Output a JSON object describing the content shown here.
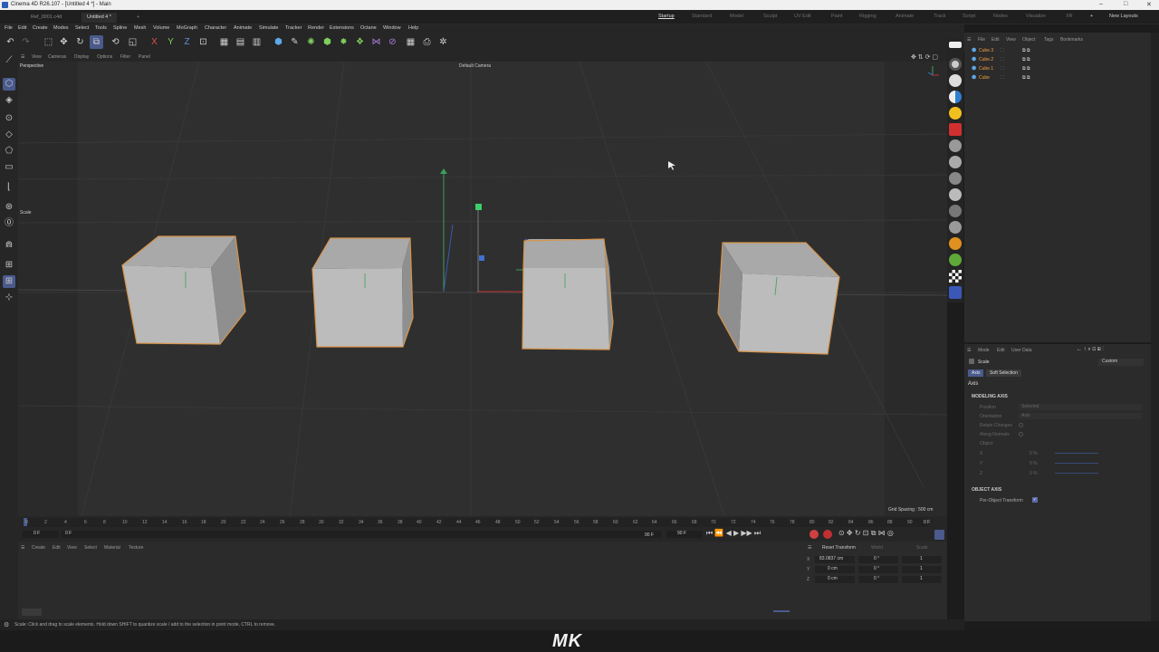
{
  "window": {
    "title": "Cinema 4D R26.107 - [Untitled 4 *] - Main",
    "controls": [
      "–",
      "□",
      "✕"
    ]
  },
  "tabs": [
    {
      "label": "Ref_0001.c4d"
    },
    {
      "label": "Untitled 4 *"
    },
    {
      "label": "+"
    }
  ],
  "layouts": [
    "Startup",
    "Standard",
    "Model",
    "Sculpt",
    "UV Edit",
    "Paint",
    "Rigging",
    "Animate",
    "Track",
    "Script",
    "Nodes",
    "Visualize",
    "XR",
    "+",
    "New Layouts"
  ],
  "menubar": [
    "File",
    "Edit",
    "Create",
    "Modes",
    "Select",
    "Tools",
    "Spline",
    "Mesh",
    "Volume",
    "MoGraph",
    "Character",
    "Animate",
    "Simulate",
    "Tracker",
    "Render",
    "Extensions",
    "Octane",
    "Window",
    "Help"
  ],
  "viewport": {
    "menu": [
      "View",
      "Cameras",
      "Display",
      "Options",
      "Filter",
      "Panel"
    ],
    "name": "Perspective",
    "camera": "Default Camera",
    "tool_label": "Scale",
    "grid_spacing": "Grid Spacing : 500 cm"
  },
  "object_manager": {
    "menu": [
      "File",
      "Edit",
      "View",
      "Object",
      "Tags",
      "Bookmarks"
    ],
    "objects": [
      {
        "name": "Cube.3"
      },
      {
        "name": "Cube.2"
      },
      {
        "name": "Cube.1"
      },
      {
        "name": "Cube"
      }
    ]
  },
  "attributes": {
    "menu": [
      "Mode",
      "Edit",
      "User Data"
    ],
    "tool": "Scale",
    "preset": "Custom",
    "tabs": [
      "Axis",
      "Soft Selection"
    ],
    "section": "Axis",
    "modeling_axis": {
      "heading": "MODELING AXIS",
      "position_label": "Position",
      "position_value": "Selected",
      "orientation_label": "Orientation",
      "orientation_value": "Axis",
      "retain_label": "Retain Changes",
      "along_label": "Along Normals",
      "object_label": "Object",
      "xyz_labels": [
        "X",
        "Y",
        "Z"
      ],
      "xyz_values": [
        "0 %",
        "0 %",
        "0 %"
      ]
    },
    "object_axis": {
      "heading": "OBJECT AXIS",
      "per_object_label": "Per-Object Transform"
    }
  },
  "timeline": {
    "ticks": [
      "0",
      "2",
      "4",
      "6",
      "8",
      "10",
      "12",
      "14",
      "16",
      "18",
      "20",
      "22",
      "24",
      "26",
      "28",
      "30",
      "32",
      "34",
      "36",
      "38",
      "40",
      "42",
      "44",
      "46",
      "48",
      "50",
      "52",
      "54",
      "56",
      "58",
      "60",
      "62",
      "64",
      "66",
      "68",
      "70",
      "72",
      "74",
      "76",
      "78",
      "80",
      "82",
      "84",
      "86",
      "88",
      "90"
    ],
    "current_frame": "0 F",
    "start_frame": "0 F",
    "range_start": "0 F",
    "range_end": "90 F",
    "end_frame": "90 F"
  },
  "material_manager": {
    "menu": [
      "Create",
      "Edit",
      "View",
      "Select",
      "Material",
      "Texture"
    ]
  },
  "coordinates": {
    "reset_label": "Reset Transform",
    "space_label": "World",
    "scale_label": "Scale",
    "rows": [
      {
        "axis": "X",
        "pos": "83.0837 cm",
        "rot": "0 °",
        "scale": "1"
      },
      {
        "axis": "Y",
        "pos": "0 cm",
        "rot": "0 °",
        "scale": "1"
      },
      {
        "axis": "Z",
        "pos": "0 cm",
        "rot": "0 °",
        "scale": "1"
      }
    ]
  },
  "status": "Scale: Click and drag to scale elements. Hold down SHIFT to quantize scale / add to the selection in point mode, CTRL to remove.",
  "watermark": "MK"
}
